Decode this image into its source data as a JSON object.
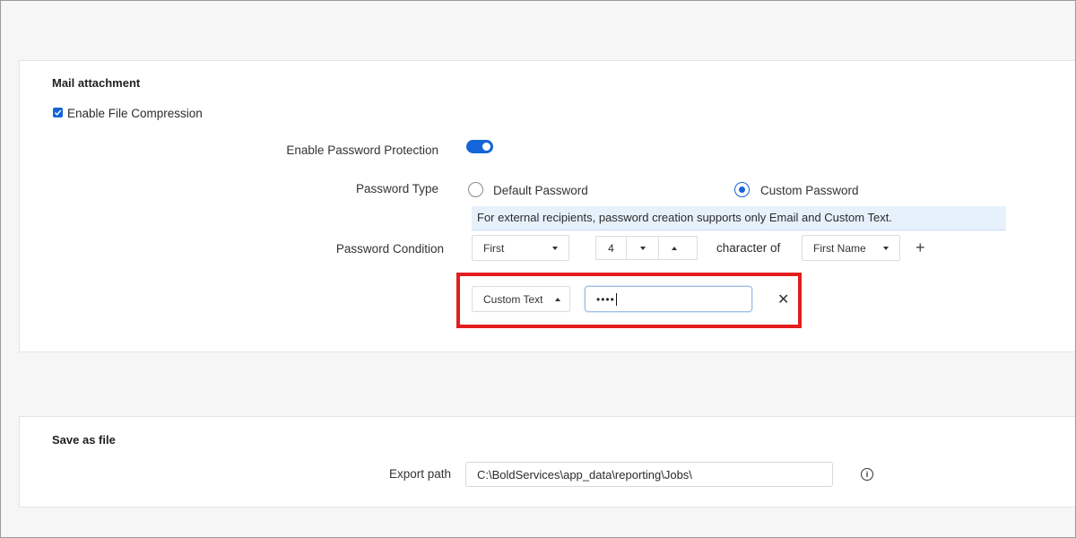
{
  "mail_attachment": {
    "title": "Mail attachment",
    "enable_compression": {
      "label": "Enable File Compression",
      "checked": true
    },
    "password_protection": {
      "label": "Enable Password Protection",
      "enabled": true
    },
    "password_type": {
      "label": "Password Type",
      "options": [
        {
          "label": "Default Password",
          "selected": false
        },
        {
          "label": "Custom Password",
          "selected": true
        }
      ]
    },
    "info_banner": "For external recipients, password creation supports only Email and Custom Text.",
    "password_condition": {
      "label": "Password Condition",
      "position": "First",
      "count": "4",
      "connector": "character of",
      "field": "First Name"
    },
    "custom_row": {
      "type": "Custom Text",
      "value_masked": "••••"
    }
  },
  "save_as_file": {
    "title": "Save as file",
    "export_path": {
      "label": "Export path",
      "value": "C:\\BoldServices\\app_data\\reporting\\Jobs\\"
    }
  },
  "colors": {
    "accent": "#1565d8",
    "highlight": "#e41d1d",
    "banner_bg": "#e7f1fc"
  },
  "icons": [
    "check-icon",
    "caret-down-icon",
    "caret-up-icon",
    "plus-icon",
    "close-icon",
    "info-icon"
  ]
}
